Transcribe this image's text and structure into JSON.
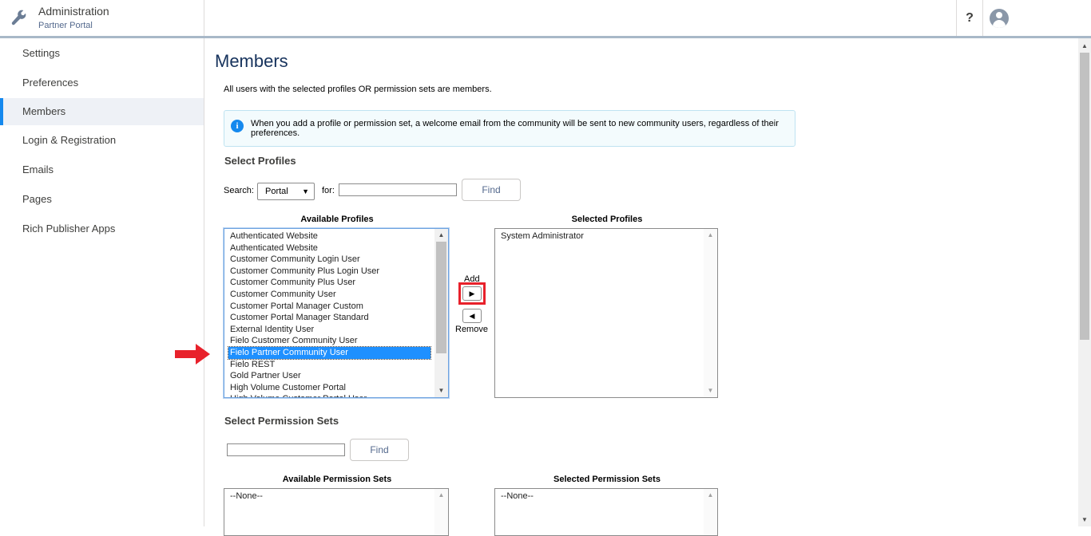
{
  "header": {
    "app_title": "Administration",
    "app_subtitle": "Partner Portal",
    "help_label": "?"
  },
  "sidebar": {
    "items": [
      {
        "label": "Settings"
      },
      {
        "label": "Preferences"
      },
      {
        "label": "Members",
        "active": true
      },
      {
        "label": "Login & Registration"
      },
      {
        "label": "Emails"
      },
      {
        "label": "Pages"
      },
      {
        "label": "Rich Publisher Apps"
      }
    ]
  },
  "main": {
    "title": "Members",
    "intro": "All users with the selected profiles OR permission sets are members.",
    "info_icon": "i",
    "info_text": "When you add a profile or permission set, a welcome email from the community will be sent to new community users, regardless of their preferences.",
    "profiles": {
      "section_title": "Select Profiles",
      "search_label": "Search:",
      "search_select_value": "Portal",
      "for_label": "for:",
      "search_input_value": "",
      "find_label": "Find",
      "available_label": "Available Profiles",
      "selected_label": "Selected Profiles",
      "available": [
        "Authenticated Website",
        "Authenticated Website",
        "Customer Community Login User",
        "Customer Community Plus Login User",
        "Customer Community Plus User",
        "Customer Community User",
        "Customer Portal Manager Custom",
        "Customer Portal Manager Standard",
        "External Identity User",
        "Fielo Customer Community User",
        "Fielo Partner Community User",
        "Fielo REST",
        "Gold Partner User",
        "High Volume Customer Portal",
        "High Volume Customer Portal User"
      ],
      "selected_index": 10,
      "selected": [
        "System Administrator"
      ],
      "add_label": "Add",
      "remove_label": "Remove"
    },
    "permission_sets": {
      "section_title": "Select Permission Sets",
      "search_input_value": "",
      "find_label": "Find",
      "available_label": "Available Permission Sets",
      "selected_label": "Selected Permission Sets",
      "available": [
        "--None--"
      ],
      "selected": [
        "--None--"
      ]
    }
  },
  "colors": {
    "accent": "#1589ee",
    "highlight_box": "#e8212b",
    "selection": "#1e90ff"
  }
}
